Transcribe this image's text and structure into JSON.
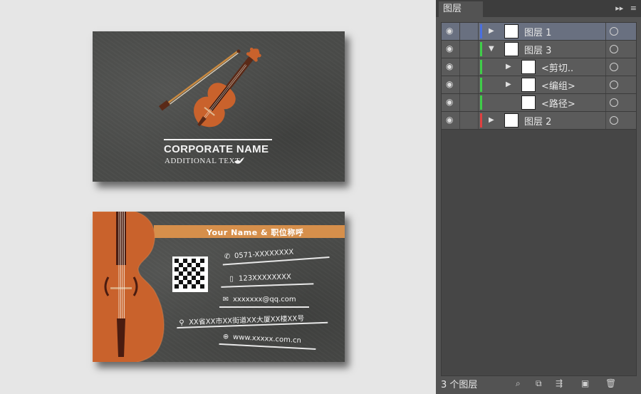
{
  "canvas": {
    "front": {
      "corporate_name": "CORPORATE NAME",
      "additional_text": "ADDITIONAL TEXT"
    },
    "back": {
      "name_title": "Your Name & 职位称呼",
      "phone": "0571-XXXXXXXX",
      "mobile": "123XXXXXXXX",
      "email": "xxxxxxx@qq.com",
      "address": "XX省XX市XX街道XX大厦XX楼XX号",
      "website": "www.xxxxx.com.cn"
    },
    "colors": {
      "card_bg": "#4a4b49",
      "accent": "#d68f4b",
      "violin": "#c9622c"
    }
  },
  "layers_panel": {
    "tab_title": "图层",
    "rows": [
      {
        "label": "图层 1",
        "color": "#4a6fe0",
        "expand": "right",
        "selected": true
      },
      {
        "label": "图层 3",
        "color": "#3fce49",
        "expand": "down",
        "selected": false
      },
      {
        "label": "<剪切..",
        "color": "#3fce49",
        "expand": "right",
        "selected": false
      },
      {
        "label": "<编组>",
        "color": "#3fce49",
        "expand": "right",
        "selected": false
      },
      {
        "label": "<路径>",
        "color": "#3fce49",
        "expand": "none",
        "selected": false
      },
      {
        "label": "图层 2",
        "color": "#e04040",
        "expand": "right",
        "selected": false
      }
    ],
    "layer_count": "3 个图层",
    "bottom_icons": [
      "search-icon",
      "clipping-mask-icon",
      "sublayer-icon",
      "new-layer-icon",
      "trash-icon"
    ]
  }
}
